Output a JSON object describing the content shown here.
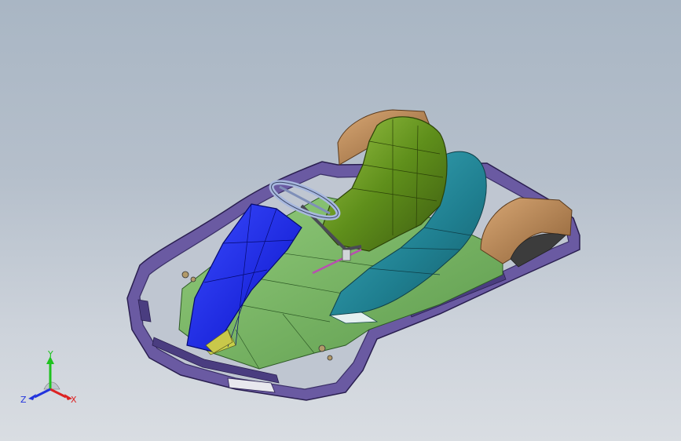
{
  "viewport": {
    "background_top": "#a9b6c4",
    "background_bottom": "#d9dde2"
  },
  "model": {
    "parts": [
      {
        "name": "chassis-frame",
        "color": "#5d4f93"
      },
      {
        "name": "floor-tray",
        "color": "#79b565"
      },
      {
        "name": "front-nose-cone",
        "color": "#1020f0"
      },
      {
        "name": "seat",
        "color": "#5f8f1b"
      },
      {
        "name": "side-pod",
        "color": "#2a8fa0"
      },
      {
        "name": "rear-bumper",
        "color": "#b88552"
      },
      {
        "name": "steering-wheel",
        "color": "#a8b8de"
      }
    ]
  },
  "triad": {
    "y_label": "Y",
    "z_label": "Z",
    "x_label": "X",
    "y_color": "#1fc21f",
    "z_color": "#2233dd",
    "x_color": "#dd2222"
  }
}
